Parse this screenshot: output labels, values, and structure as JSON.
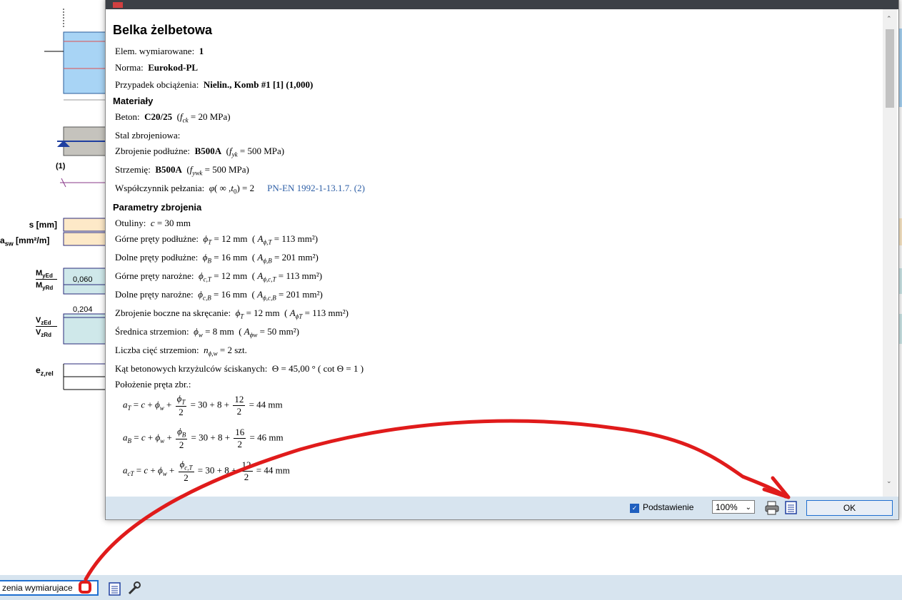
{
  "report": {
    "title": "Belka żelbetowa",
    "elem_label": "Elem. wymiarowane:",
    "elem_value": "1",
    "norma_label": "Norma:",
    "norma_value": "Eurokod-PL",
    "case_label": "Przypadek obciążenia:",
    "case_value": "Nielin., Komb #1 [1] (1,000)",
    "materials_heading": "Materiały",
    "beton_label": "Beton:",
    "beton_value": "C20/25",
    "beton_param": "20 MPa",
    "stal_label": "Stal zbrojeniowa:",
    "podluzne_label": "Zbrojenie podłużne:",
    "podluzne_value": "B500A",
    "podluzne_param": "500 MPa",
    "strzemie_label": "Strzemię:",
    "strzemie_value": "B500A",
    "strzemie_param": "500 MPa",
    "pelzanie_label": "Współczynnik pełzania:",
    "pelzanie_value": "2",
    "pelzanie_ref": "PN-EN 1992-1-13.1.7. (2)",
    "param_heading": "Parametry zbrojenia",
    "otuliny_label": "Otuliny:",
    "otuliny_value": "30 mm",
    "gorne_label": "Górne pręty podłużne:",
    "gorne_value": "12 mm",
    "gorne_area": "113 mm²",
    "dolne_label": "Dolne pręty podłużne:",
    "dolne_value": "16 mm",
    "dolne_area": "201 mm²",
    "gorne_n_label": "Górne pręty narożne:",
    "gorne_n_value": "12 mm",
    "gorne_n_area": "113 mm²",
    "dolne_n_label": "Dolne pręty narożne:",
    "dolne_n_value": "16 mm",
    "dolne_n_area": "201 mm²",
    "boczne_label": "Zbrojenie boczne na skręcanie:",
    "boczne_value": "12 mm",
    "boczne_area": "113 mm²",
    "srednica_label": "Średnica strzemion:",
    "srednica_value": "8 mm",
    "srednica_area": "50 mm²",
    "ciec_label": "Liczba cięć strzemion:",
    "ciec_value": "2 szt.",
    "kat_label": "Kąt betonowych krzyżulców ściskanych:",
    "kat_value": "45,00 °",
    "kat_cot": "1",
    "polozenie_label": "Położenie pręta zbr.:",
    "eq1_result": "= 30 + 8 +",
    "eq1_num": "12",
    "eq1_end": "= 44 mm",
    "eq2_num": "16",
    "eq2_end": "= 46 mm",
    "eq3_num": "12",
    "eq3_end": "= 44 mm",
    "den": "2"
  },
  "footer": {
    "checkbox_label": "Podstawienie",
    "checkbox_checked": true,
    "zoom_value": "100%",
    "ok_label": "OK"
  },
  "background": {
    "marker": "(1)",
    "s_label": "s [mm]",
    "asw_label": "a",
    "asw_sub": "sw",
    "asw_unit": "[mm²/m]",
    "m_top": "M",
    "m_top_sub": "yEd",
    "m_bot": "M",
    "m_bot_sub": "yRd",
    "m_value": "0,060",
    "v_top": "V",
    "v_top_sub": "zEd",
    "v_bot": "V",
    "v_bot_sub": "zRd",
    "v_value": "0,204",
    "e_label": "e",
    "e_sub": "z,rel"
  },
  "bottom": {
    "field_text": "zenia wymiarujace"
  },
  "colors": {
    "annotation": "#e01b1b",
    "accent": "#1f6fd0"
  }
}
